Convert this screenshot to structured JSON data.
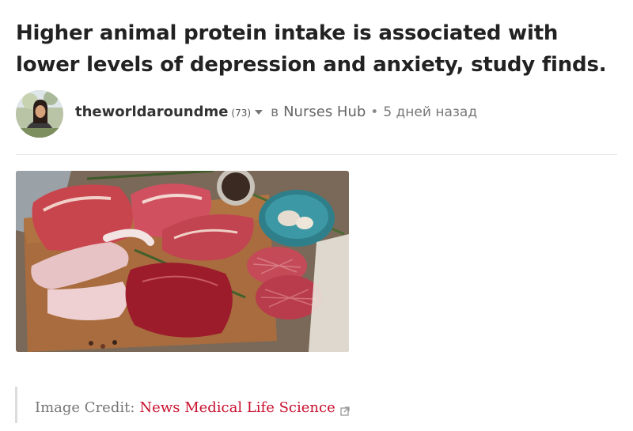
{
  "post": {
    "title": "Higher animal protein intake is associated with lower levels of depression and anxiety, study finds.",
    "author": "theworldaroundme",
    "reputation": "(73)",
    "in_word": "в",
    "community": "Nurses Hub",
    "separator": "•",
    "time_ago": "5 дней назад",
    "image_alt": "Assorted raw meats on a wooden board"
  },
  "credit": {
    "label": "Image Credit:",
    "source": "News Medical Life Science"
  },
  "icons": {
    "author_menu": "chevron-down-icon",
    "external_link": "external-link-icon"
  },
  "colors": {
    "link": "#c8102e",
    "text": "#222222",
    "muted": "#777777"
  }
}
